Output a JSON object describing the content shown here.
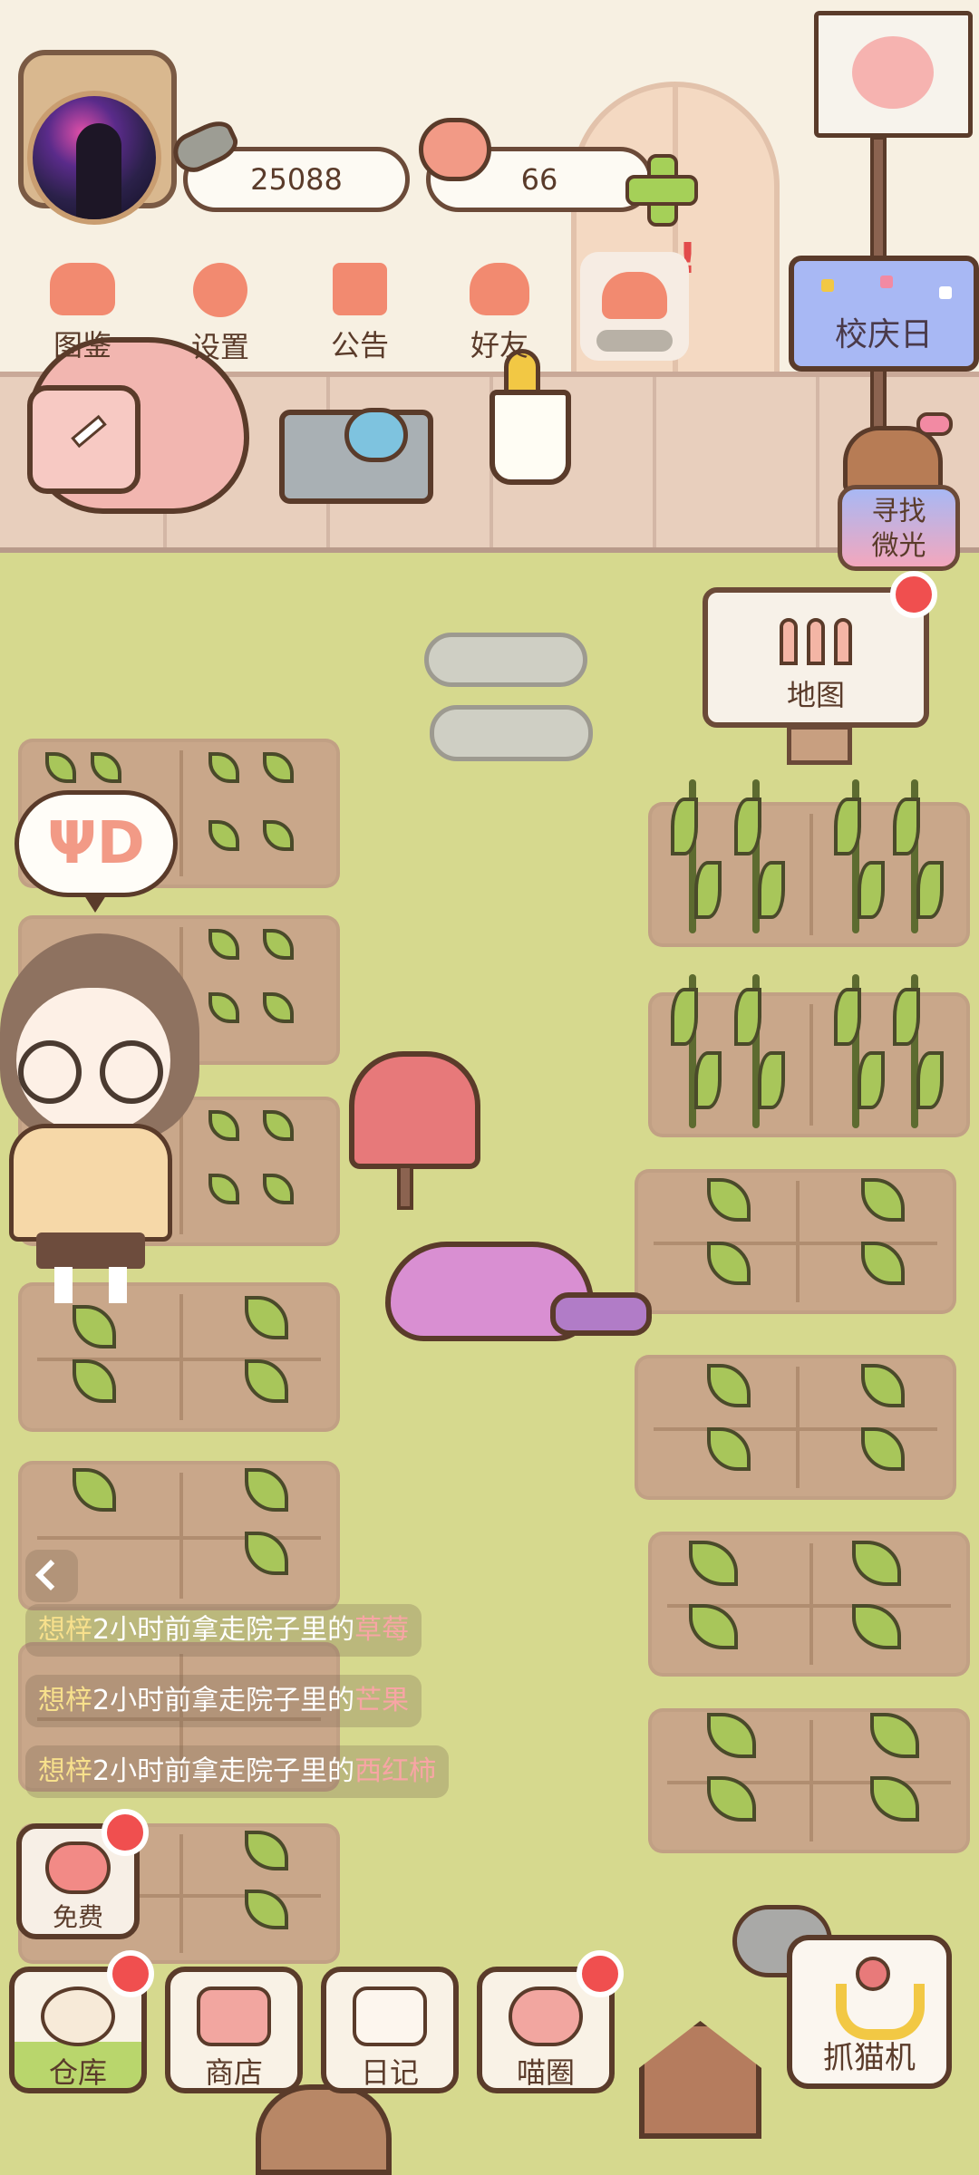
{
  "currency": {
    "coins": "25088",
    "hearts": "66"
  },
  "top_menu": [
    {
      "label": "图鉴"
    },
    {
      "label": "设置"
    },
    {
      "label": "公告"
    },
    {
      "label": "好友"
    }
  ],
  "event": {
    "banner_label": "校庆日",
    "search_label_line1": "寻找",
    "search_label_line2": "微光"
  },
  "map": {
    "label": "地图"
  },
  "activity_feed": [
    {
      "who": "想梓",
      "text": "2小时前拿走院子里的",
      "item": "草莓"
    },
    {
      "who": "想梓",
      "text": "2小时前拿走院子里的",
      "item": "芒果"
    },
    {
      "who": "想梓",
      "text": "2小时前拿走院子里的",
      "item": "西红柿"
    }
  ],
  "free": {
    "label": "免费"
  },
  "dock": [
    {
      "label": "仓库"
    },
    {
      "label": "商店"
    },
    {
      "label": "日记"
    },
    {
      "label": "喵圈"
    }
  ],
  "claw_machine": {
    "label": "抓猫机"
  },
  "colors": {
    "grass": "#d6d98e",
    "soil": "#c9a78a",
    "accent_pink": "#f28a70",
    "notification_red": "#f04f4f",
    "text_brown": "#5a3b2a"
  }
}
